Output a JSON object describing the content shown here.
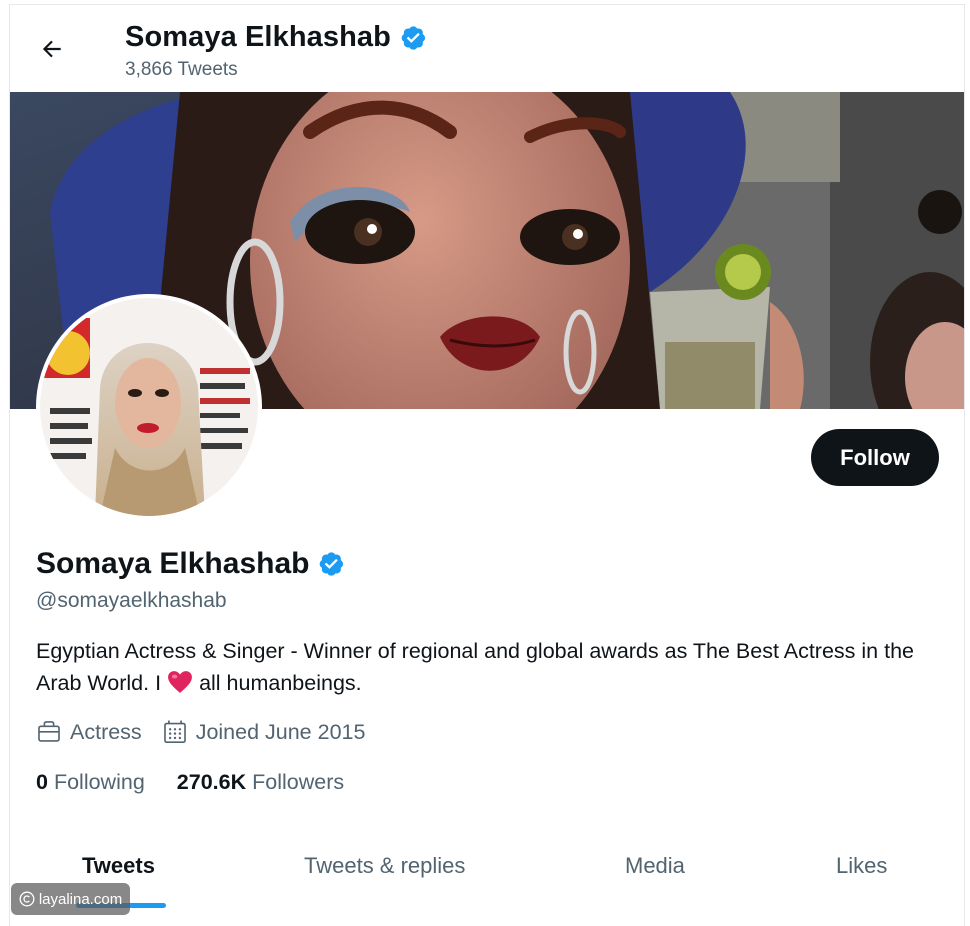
{
  "header": {
    "name": "Somaya Elkhashab",
    "tweet_count": "3,866 Tweets"
  },
  "profile": {
    "name": "Somaya Elkhashab",
    "handle": "@somayaelkhashab",
    "bio_part1": "Egyptian Actress & Singer - Winner of regional and global awards as The Best Actress in the Arab World. I",
    "bio_part2": "all humanbeings.",
    "occupation": "Actress",
    "joined": "Joined June 2015",
    "following_count": "0",
    "following_label": "Following",
    "followers_count": "270.6K",
    "followers_label": "Followers",
    "follow_button": "Follow"
  },
  "tabs": [
    "Tweets",
    "Tweets & replies",
    "Media",
    "Likes"
  ],
  "active_tab": "Tweets",
  "watermark": "layalina.com",
  "colors": {
    "accent": "#1d9bf0",
    "verified": "#1d9bf0",
    "text_primary": "#0f1419",
    "text_secondary": "#536471",
    "follow_button_bg": "#0f1419",
    "heart": "#e0245e"
  },
  "icons": {
    "back": "arrow-left-icon",
    "verified": "verified-badge-icon",
    "occupation": "briefcase-icon",
    "joined": "calendar-icon",
    "heart": "heart-emoji-icon"
  }
}
